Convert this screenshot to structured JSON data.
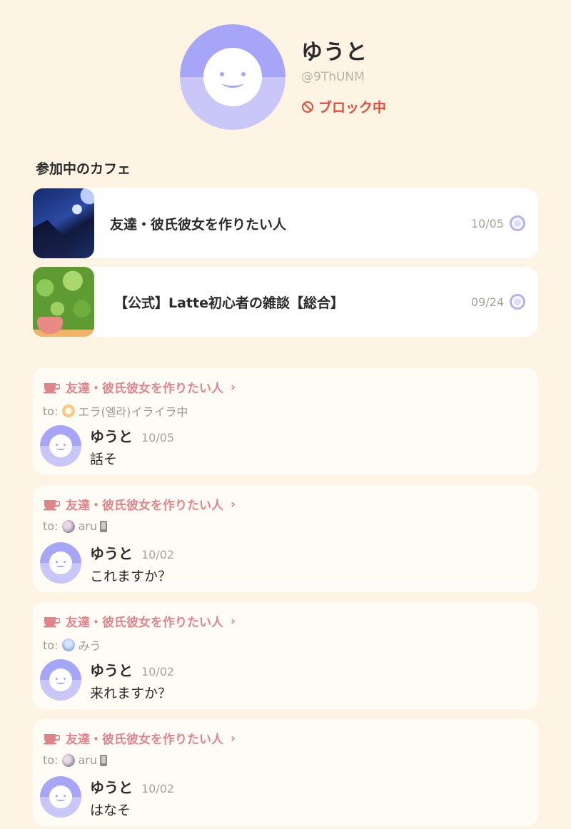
{
  "profile": {
    "name": "ゆうと",
    "handle": "@9ThUNM",
    "status": "ブロック中"
  },
  "cafes_section": {
    "title": "参加中のカフェ",
    "items": [
      {
        "name": "友達・彼氏彼女を作りたい人",
        "date": "10/05"
      },
      {
        "name": "【公式】Latte初心者の雑談【総合】",
        "date": "09/24"
      }
    ]
  },
  "posts": [
    {
      "cafe": "友達・彼氏彼女を作りたい人",
      "to_label": "to:",
      "to_name": "エラ(엘라)イライラ中",
      "author": "ゆうと",
      "date": "10/05",
      "message": "話そ"
    },
    {
      "cafe": "友達・彼氏彼女を作りたい人",
      "to_label": "to:",
      "to_name": "aru",
      "author": "ゆうと",
      "date": "10/02",
      "message": "これますか？"
    },
    {
      "cafe": "友達・彼氏彼女を作りたい人",
      "to_label": "to:",
      "to_name": "みう",
      "author": "ゆうと",
      "date": "10/02",
      "message": "来れますか？"
    },
    {
      "cafe": "友達・彼氏彼女を作りたい人",
      "to_label": "to:",
      "to_name": "aru",
      "author": "ゆうと",
      "date": "10/02",
      "message": "はなそ"
    }
  ],
  "colors": {
    "background": "#fdf4e3",
    "accent_pink": "#e0848b",
    "blocked_red": "#e24a3b",
    "avatar_purple": "#a7a5f7"
  }
}
